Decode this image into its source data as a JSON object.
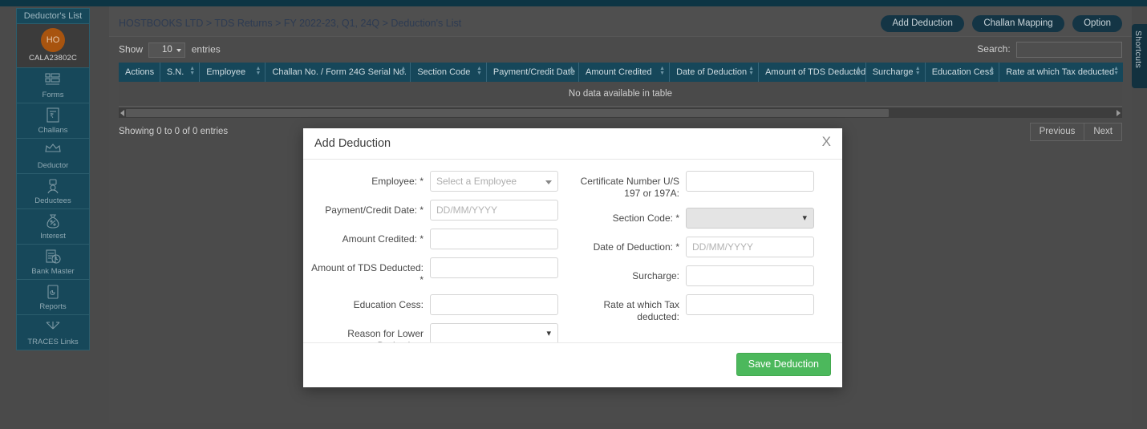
{
  "theme": {
    "top_strip": "#0d3544",
    "sidebar_bg": "#17485a",
    "accent_header": "#16475a",
    "avatar_bg": "#a8540f",
    "save_green": "#4cb85c",
    "page_dim": "#4a4a4a"
  },
  "sidebar": {
    "title": "Deductor's List",
    "account": {
      "initials": "HO",
      "code": "CALA23802C"
    },
    "items": [
      {
        "label": "Forms",
        "icon": "forms-icon"
      },
      {
        "label": "Challans",
        "icon": "challan-icon"
      },
      {
        "label": "Deductor",
        "icon": "deductor-icon"
      },
      {
        "label": "Deductees",
        "icon": "deductees-icon"
      },
      {
        "label": "Interest",
        "icon": "interest-icon"
      },
      {
        "label": "Bank Master",
        "icon": "bank-master-icon"
      },
      {
        "label": "Reports",
        "icon": "reports-icon"
      },
      {
        "label": "TRACES Links",
        "icon": "traces-links-icon"
      }
    ]
  },
  "header": {
    "breadcrumb": "HOSTBOOKS LTD > TDS Returns > FY 2022-23, Q1, 24Q > Deduction's List",
    "buttons": [
      {
        "label": "Add Deduction",
        "name": "add-deduction-button"
      },
      {
        "label": "Challan Mapping",
        "name": "challan-mapping-button"
      },
      {
        "label": "Option",
        "name": "option-button"
      }
    ]
  },
  "toolbar": {
    "show_label": "Show",
    "entries_value": "10",
    "entries_label": "entries",
    "search_label": "Search:",
    "search_value": "",
    "search_placeholder": ""
  },
  "table": {
    "columns": [
      "Actions",
      "S.N.",
      "Employee",
      "Challan No. / Form 24G Serial No.",
      "Section Code",
      "Payment/Credit Date",
      "Amount Credited",
      "Date of Deduction",
      "Amount of TDS Deducted",
      "Surcharge",
      "Education Cess",
      "Rate at which Tax deducted"
    ],
    "empty_message": "No data available in table",
    "rows": []
  },
  "footer": {
    "showing_info": "Showing 0 to 0 of 0 entries",
    "previous_label": "Previous",
    "next_label": "Next"
  },
  "modal": {
    "title": "Add Deduction",
    "close_label": "X",
    "left_fields": [
      {
        "label": "Employee:",
        "required": true,
        "type": "select2",
        "value": "Select a Employee",
        "name": "employee-select"
      },
      {
        "label": "Payment/Credit Date:",
        "required": true,
        "type": "text",
        "value": "",
        "placeholder": "DD/MM/YYYY",
        "name": "payment-credit-date-field"
      },
      {
        "label": "Amount Credited:",
        "required": true,
        "type": "text",
        "value": "",
        "placeholder": "",
        "name": "amount-credited-field"
      },
      {
        "label": "Amount of TDS Deducted:",
        "required": true,
        "type": "text",
        "value": "",
        "placeholder": "",
        "name": "amount-tds-deducted-field"
      },
      {
        "label": "Education Cess:",
        "required": false,
        "type": "text",
        "value": "",
        "placeholder": "",
        "name": "education-cess-field"
      },
      {
        "label": "Reason for Lower Deduction:",
        "required": false,
        "type": "select",
        "value": "",
        "name": "reason-lower-deduction-select"
      }
    ],
    "right_fields": [
      {
        "label": "Certificate Number U/S 197 or 197A:",
        "required": false,
        "type": "text",
        "value": "",
        "placeholder": "",
        "name": "certificate-number-field"
      },
      {
        "label": "Section Code:",
        "required": true,
        "type": "select-grey",
        "value": "",
        "name": "section-code-select"
      },
      {
        "label": "Date of Deduction:",
        "required": true,
        "type": "text",
        "value": "",
        "placeholder": "DD/MM/YYYY",
        "name": "date-of-deduction-field"
      },
      {
        "label": "Surcharge:",
        "required": false,
        "type": "text",
        "value": "",
        "placeholder": "",
        "name": "surcharge-field"
      },
      {
        "label": "Rate at which Tax deducted:",
        "required": false,
        "type": "text",
        "value": "",
        "placeholder": "",
        "name": "rate-tax-deducted-field"
      }
    ],
    "save_label": "Save Deduction"
  },
  "shortcuts": {
    "label": "Shortcuts"
  }
}
